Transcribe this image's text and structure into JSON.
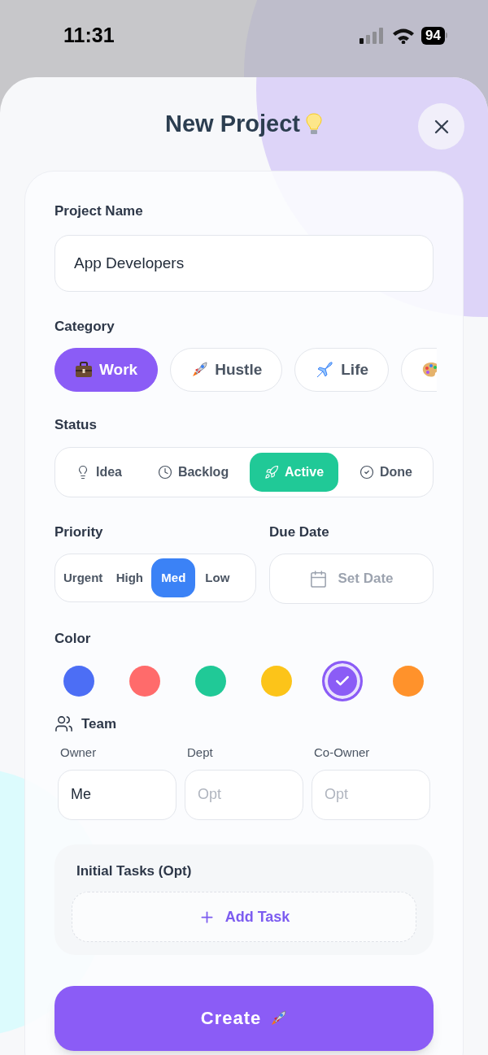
{
  "status_bar": {
    "time": "11:31",
    "battery": "94"
  },
  "header": {
    "title": "New Project"
  },
  "project_name": {
    "label": "Project Name",
    "value": "App Developers"
  },
  "category": {
    "label": "Category",
    "items": [
      {
        "kind": "work",
        "label": "Work",
        "selected": true
      },
      {
        "kind": "hustle",
        "label": "Hustle",
        "selected": false
      },
      {
        "kind": "life",
        "label": "Life",
        "selected": false
      },
      {
        "kind": "art",
        "selected": false
      }
    ]
  },
  "status": {
    "label": "Status",
    "items": [
      {
        "kind": "idea",
        "label": "Idea",
        "selected": false
      },
      {
        "kind": "backlog",
        "label": "Backlog",
        "selected": false
      },
      {
        "kind": "active",
        "label": "Active",
        "selected": true
      },
      {
        "kind": "done",
        "label": "Done",
        "selected": false
      }
    ]
  },
  "priority": {
    "label": "Priority",
    "items": [
      {
        "label": "Urgent",
        "selected": false
      },
      {
        "label": "High",
        "selected": false
      },
      {
        "label": "Med",
        "selected": true
      },
      {
        "label": "Low",
        "selected": false
      }
    ]
  },
  "due_date": {
    "label": "Due Date",
    "button": "Set Date"
  },
  "color": {
    "label": "Color",
    "items": [
      {
        "color": "#4c6ef5",
        "selected": false
      },
      {
        "color": "#ff6b6b",
        "selected": false
      },
      {
        "color": "#20c997",
        "selected": false
      },
      {
        "color": "#fcc419",
        "selected": false
      },
      {
        "color": "#8b5cf6",
        "selected": true
      },
      {
        "color": "#ff922b",
        "selected": false
      }
    ]
  },
  "team": {
    "label": "Team",
    "fields": [
      {
        "label": "Owner",
        "value": "Me"
      },
      {
        "label": "Dept",
        "placeholder": "Opt"
      },
      {
        "label": "Co-Owner",
        "placeholder": "Opt"
      }
    ]
  },
  "tasks": {
    "label": "Initial Tasks (Opt)",
    "button": "Add Task"
  },
  "create_button": "Create"
}
